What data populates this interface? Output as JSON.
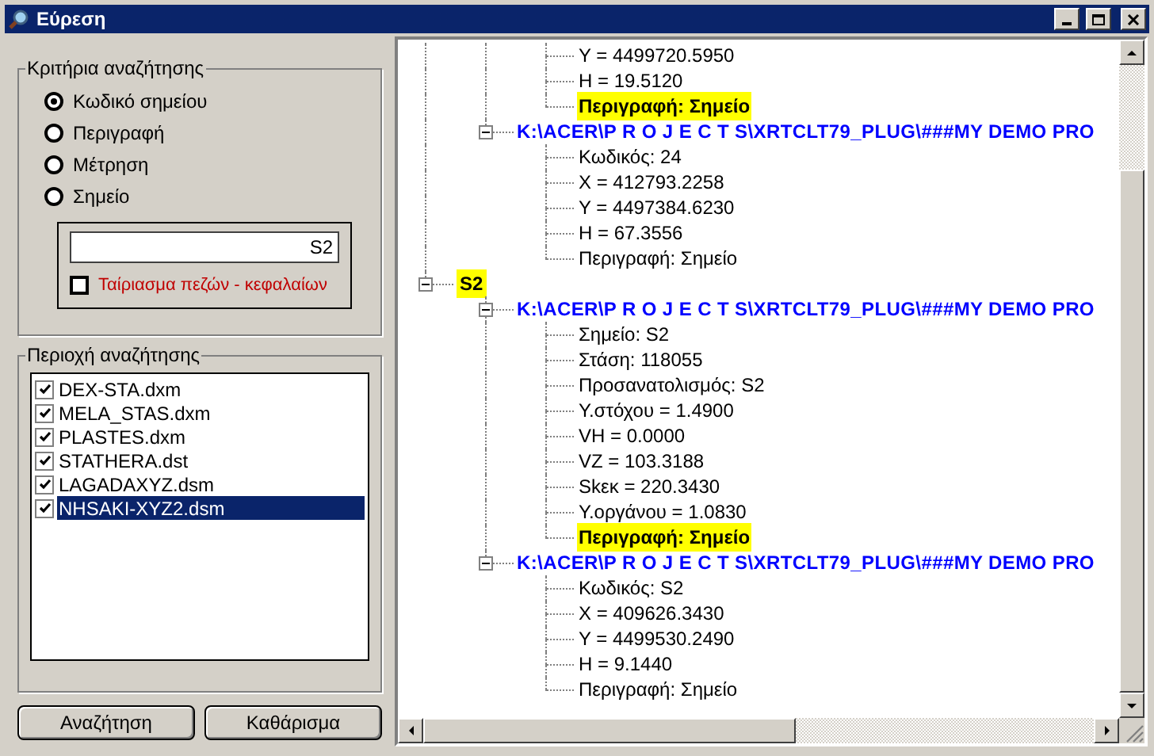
{
  "window": {
    "title": "Εύρεση"
  },
  "criteria": {
    "title": "Κριτήρια αναζήτησης",
    "options": [
      {
        "label": "Κωδικό σημείου",
        "selected": true
      },
      {
        "label": "Περιγραφή",
        "selected": false
      },
      {
        "label": "Μέτρηση",
        "selected": false
      },
      {
        "label": "Σημείο",
        "selected": false
      }
    ],
    "search": {
      "value": "S2"
    },
    "match_case": {
      "label": "Ταίριασμα πεζών - κεφαλαίων",
      "checked": false
    }
  },
  "area": {
    "title": "Περιοχή αναζήτησης",
    "files": [
      {
        "name": "DEX-STA.dxm",
        "checked": true,
        "selected": false
      },
      {
        "name": "MELA_STAS.dxm",
        "checked": true,
        "selected": false
      },
      {
        "name": "PLASTES.dxm",
        "checked": true,
        "selected": false
      },
      {
        "name": "STATHERA.dst",
        "checked": true,
        "selected": false
      },
      {
        "name": "LAGADAXYZ.dsm",
        "checked": true,
        "selected": false
      },
      {
        "name": "NHSAKI-XYZ2.dsm",
        "checked": true,
        "selected": true
      }
    ]
  },
  "buttons": [
    "Αναζήτηση",
    "Καθάρισμα"
  ],
  "tree": {
    "nodes": [
      {
        "kind": "hidden",
        "children": [
          {
            "kind": "hidden",
            "children": [
              {
                "kind": "field",
                "label": "Y = 4499720.5950",
                "highlight": false
              },
              {
                "kind": "field",
                "label": "H = 19.5120",
                "highlight": false
              },
              {
                "kind": "field",
                "label": "Περιγραφή: Σημείο",
                "highlight": true
              }
            ]
          },
          {
            "kind": "path",
            "label": "K:\\ACER\\P R O J E C T S\\XRTCLT79_PLUG\\###MY DEMO PRO",
            "expanded": true,
            "children": [
              {
                "kind": "field",
                "label": "Κωδικός: 24",
                "highlight": false
              },
              {
                "kind": "field",
                "label": "X = 412793.2258",
                "highlight": false
              },
              {
                "kind": "field",
                "label": "Y = 4497384.6230",
                "highlight": false
              },
              {
                "kind": "field",
                "label": "H = 67.3556",
                "highlight": false
              },
              {
                "kind": "field",
                "label": "Περιγραφή: Σημείο",
                "highlight": false
              }
            ]
          }
        ]
      },
      {
        "kind": "point",
        "label": "S2",
        "expanded": true,
        "children": [
          {
            "kind": "path",
            "label": "K:\\ACER\\P R O J E C T S\\XRTCLT79_PLUG\\###MY DEMO PRO",
            "expanded": true,
            "children": [
              {
                "kind": "field",
                "label": "Σημείο: S2",
                "highlight": false
              },
              {
                "kind": "field",
                "label": "Στάση: 118055",
                "highlight": false
              },
              {
                "kind": "field",
                "label": "Προσανατολισμός: S2",
                "highlight": false
              },
              {
                "kind": "field",
                "label": "Υ.στόχου = 1.4900",
                "highlight": false
              },
              {
                "kind": "field",
                "label": "VH = 0.0000",
                "highlight": false
              },
              {
                "kind": "field",
                "label": "VZ = 103.3188",
                "highlight": false
              },
              {
                "kind": "field",
                "label": "Skεκ = 220.3430",
                "highlight": false
              },
              {
                "kind": "field",
                "label": "Υ.οργάνου = 1.0830",
                "highlight": false
              },
              {
                "kind": "field",
                "label": "Περιγραφή: Σημείο",
                "highlight": true
              }
            ]
          },
          {
            "kind": "path",
            "label": "K:\\ACER\\P R O J E C T S\\XRTCLT79_PLUG\\###MY DEMO PRO",
            "expanded": true,
            "children": [
              {
                "kind": "field",
                "label": "Κωδικός: S2",
                "highlight": false
              },
              {
                "kind": "field",
                "label": "X = 409626.3430",
                "highlight": false
              },
              {
                "kind": "field",
                "label": "Y = 4499530.2490",
                "highlight": false
              },
              {
                "kind": "field",
                "label": "H = 9.1440",
                "highlight": false
              },
              {
                "kind": "field",
                "label": "Περιγραφή: Σημείο",
                "highlight": false
              }
            ]
          }
        ]
      }
    ]
  }
}
